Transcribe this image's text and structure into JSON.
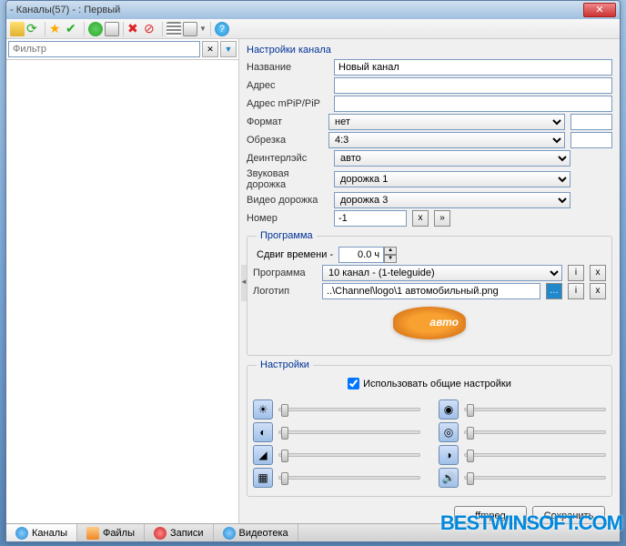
{
  "title": "- Каналы(57) -  : Первый",
  "filter": {
    "placeholder": "Фильтр"
  },
  "settings_title": "Настройки канала",
  "fields": {
    "name_label": "Название",
    "name_value": "Новый канал",
    "addr_label": "Адрес",
    "addr2_label": "Адрес mPiP/PiP",
    "format_label": "Формат",
    "format_value": "нет",
    "crop_label": "Обрезка",
    "crop_value": "4:3",
    "deint_label": "Деинтерлэйс",
    "deint_value": "авто",
    "audio_label": "Звуковая дорожка",
    "audio_value": "дорожка 1",
    "video_label": "Видео дорожка",
    "video_value": "дорожка 3",
    "number_label": "Номер",
    "number_value": "-1"
  },
  "program": {
    "legend": "Программа",
    "shift_label": "Сдвиг времени -",
    "shift_value": "0.0 ч",
    "prog_label": "Программа",
    "prog_value": "10 канал - (1-teleguide)",
    "logo_label": "Логотип",
    "logo_value": "..\\Channel\\logo\\1 автомобильный.png"
  },
  "settings2": {
    "legend": "Настройки",
    "use_common": "Использовать общие настройки"
  },
  "buttons": {
    "ffmpeg": "ffmpeg",
    "save": "Сохранить"
  },
  "tabs": {
    "channels": "Каналы",
    "files": "Файлы",
    "records": "Записи",
    "library": "Видеотека"
  },
  "watermark": "BESTWINSOFT.COM"
}
